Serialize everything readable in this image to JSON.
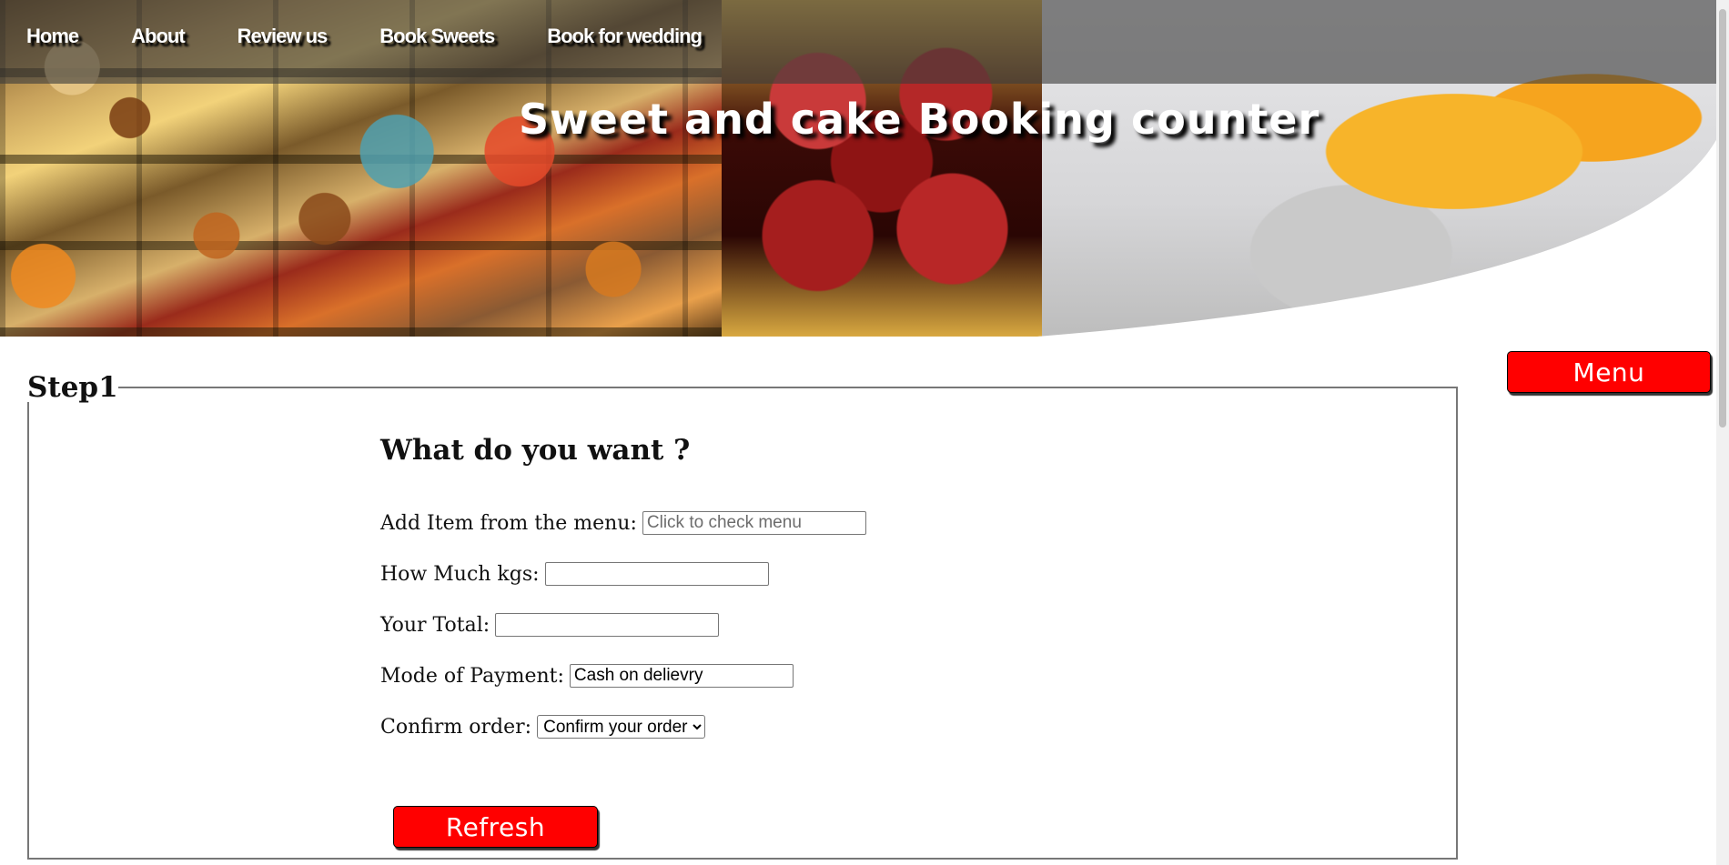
{
  "nav": {
    "items": [
      {
        "label": "Home"
      },
      {
        "label": "About"
      },
      {
        "label": "Review us"
      },
      {
        "label": "Book Sweets"
      },
      {
        "label": "Book for wedding"
      }
    ]
  },
  "header": {
    "title": "Sweet and cake Booking counter"
  },
  "menu_button": {
    "label": "Menu"
  },
  "step": {
    "legend": "Step1",
    "heading": "What do you want ?",
    "fields": {
      "item": {
        "label": "Add Item from the menu:",
        "placeholder": "Click to check menu",
        "value": ""
      },
      "kgs": {
        "label": "How Much kgs:",
        "value": ""
      },
      "total": {
        "label": "Your Total:",
        "value": ""
      },
      "payment": {
        "label": "Mode of Payment:",
        "value": "Cash on delievry"
      },
      "confirm": {
        "label": "Confirm order:",
        "selected": "Confirm your order"
      }
    },
    "refresh_label": "Refresh"
  },
  "colors": {
    "button_red": "#ff0000",
    "nav_overlay": "#3c3c3c"
  }
}
